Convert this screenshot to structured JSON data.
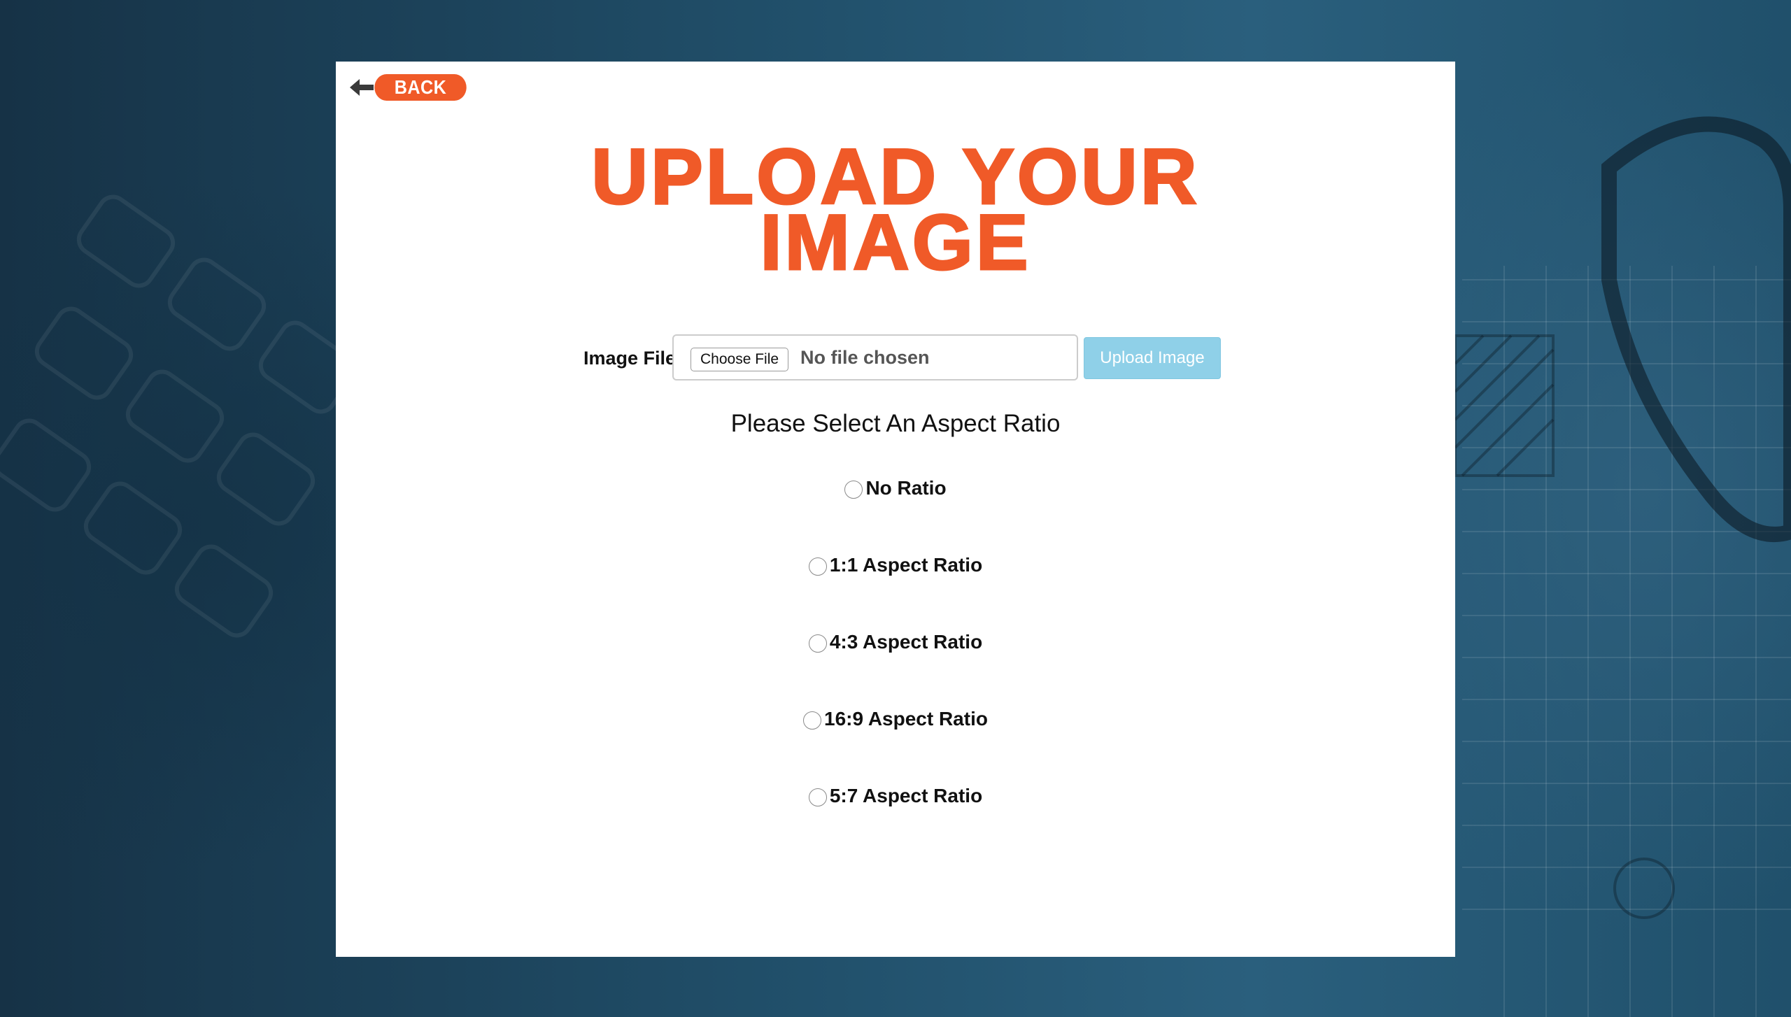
{
  "header": {
    "back_label": "BACK",
    "back_icon": "arrow-left-icon"
  },
  "main": {
    "title_line1": "UPLOAD YOUR",
    "title_line2": "IMAGE",
    "file_label": "Image File",
    "choose_file_label": "Choose File",
    "no_file_text": "No file chosen",
    "upload_button_label": "Upload Image",
    "aspect_heading": "Please Select An Aspect Ratio",
    "ratio_options": [
      {
        "label": "No Ratio",
        "selected": false
      },
      {
        "label": "1:1 Aspect Ratio",
        "selected": false
      },
      {
        "label": "4:3 Aspect Ratio",
        "selected": false
      },
      {
        "label": "16:9 Aspect Ratio",
        "selected": false
      },
      {
        "label": "5:7 Aspect Ratio",
        "selected": false
      }
    ]
  },
  "colors": {
    "accent": "#f05a28",
    "upload_button": "#8fd0e8",
    "background": "#1d4a63",
    "card": "#ffffff"
  }
}
